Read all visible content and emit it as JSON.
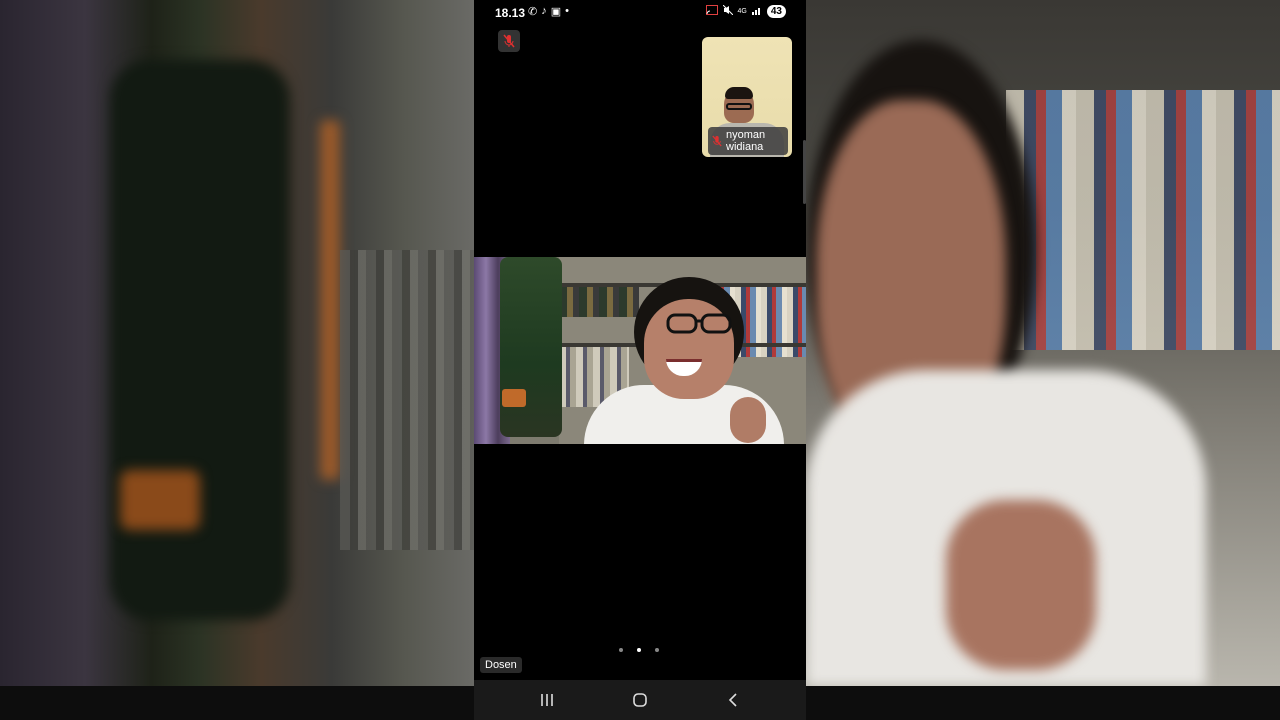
{
  "status_bar": {
    "time": "18.13",
    "left_icons": [
      "whatsapp-icon",
      "tiktok-icon",
      "video-icon",
      "dot-icon"
    ],
    "right_icons": [
      "cast-icon",
      "mute-icon",
      "4g-icon",
      "signal-icon"
    ],
    "battery": "43"
  },
  "self_view": {
    "mic_state_icon": "mic-off-icon"
  },
  "participant": {
    "name": "nyoman widiana",
    "mic_state_icon": "mic-off-icon"
  },
  "main_video": {
    "role_label": "Dosen"
  },
  "pager": {
    "count": 3,
    "active_index": 1
  },
  "navigation": {
    "buttons": [
      "recent-apps-icon",
      "home-icon",
      "back-icon"
    ]
  },
  "colors": {
    "mic_off": "#e03030",
    "background": "#000000",
    "navbar": "#1a1a1a"
  }
}
